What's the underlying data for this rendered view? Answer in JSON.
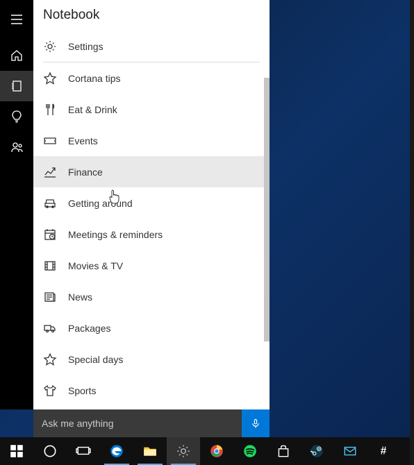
{
  "header": {
    "title": "Notebook"
  },
  "sidebar": {
    "items": [
      {
        "name": "hamburger-icon"
      },
      {
        "name": "home-icon"
      },
      {
        "name": "notebook-icon"
      },
      {
        "name": "lightbulb-icon"
      },
      {
        "name": "person-icon"
      }
    ],
    "active_index": 2
  },
  "list": {
    "items": [
      {
        "icon": "gear-icon",
        "label": "Settings",
        "divider_after": true
      },
      {
        "icon": "star-icon",
        "label": "Cortana tips"
      },
      {
        "icon": "fork-knife-icon",
        "label": "Eat & Drink"
      },
      {
        "icon": "ticket-icon",
        "label": "Events"
      },
      {
        "icon": "chart-line-icon",
        "label": "Finance",
        "hovered": true
      },
      {
        "icon": "car-icon",
        "label": "Getting around"
      },
      {
        "icon": "calendar-clock-icon",
        "label": "Meetings & reminders"
      },
      {
        "icon": "film-icon",
        "label": "Movies & TV"
      },
      {
        "icon": "newspaper-icon",
        "label": "News"
      },
      {
        "icon": "truck-icon",
        "label": "Packages"
      },
      {
        "icon": "star-icon",
        "label": "Special days"
      },
      {
        "icon": "tshirt-icon",
        "label": "Sports"
      }
    ]
  },
  "search": {
    "placeholder": "Ask me anything"
  },
  "taskbar": {
    "items": [
      {
        "name": "start-button"
      },
      {
        "name": "cortana-button"
      },
      {
        "name": "taskview-button"
      },
      {
        "name": "edge-browser"
      },
      {
        "name": "file-explorer"
      },
      {
        "name": "settings-app",
        "active": true
      },
      {
        "name": "chrome-browser"
      },
      {
        "name": "spotify-app"
      },
      {
        "name": "store-app"
      },
      {
        "name": "steam-app"
      },
      {
        "name": "mail-app"
      },
      {
        "name": "slack-app"
      }
    ]
  }
}
